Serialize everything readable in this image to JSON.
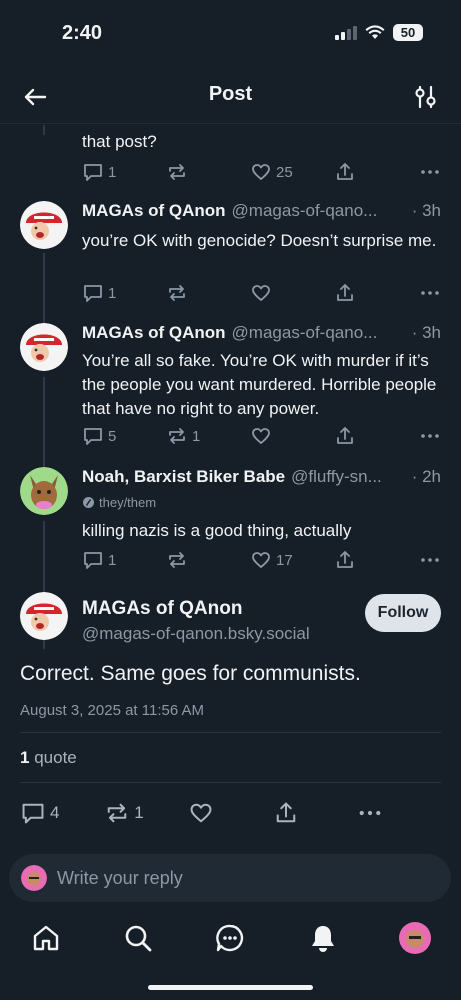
{
  "status": {
    "time": "2:40",
    "battery": "50"
  },
  "header": {
    "title": "Post"
  },
  "top_partial": {
    "text": "that post?",
    "reply_count": "1",
    "like_count": "25"
  },
  "replies": [
    {
      "author": "MAGAs of QAnon",
      "handle": "@magas-of-qano...",
      "time": "· 3h",
      "text": "you’re OK with genocide? Doesn’t surprise me.",
      "reply_count": "1",
      "repost_count": "",
      "like_count": ""
    },
    {
      "author": "MAGAs of QAnon",
      "handle": "@magas-of-qano...",
      "time": "· 3h",
      "text": "You’re all so fake. You’re OK with murder if it’s the people you want murdered. Horrible people that have no right to any power.",
      "reply_count": "5",
      "repost_count": "1",
      "like_count": ""
    },
    {
      "author": "Noah, Barxist Biker Babe",
      "handle": "@fluffy-sn...",
      "time": "· 2h",
      "pronouns": "they/them",
      "text": "killing nazis is a good thing, actually",
      "reply_count": "1",
      "repost_count": "",
      "like_count": "17"
    }
  ],
  "main_post": {
    "author": "MAGAs of QAnon",
    "handle": "@magas-of-qanon.bsky.social",
    "follow_label": "Follow",
    "text": "Correct. Same goes for communists.",
    "date": "August 3, 2025 at 11:56 AM",
    "quote_count": "1",
    "quote_label": "quote",
    "reply_count": "4",
    "repost_count": "1"
  },
  "composer": {
    "placeholder": "Write your reply"
  },
  "tabs": [
    "home-icon",
    "search-icon",
    "chat-icon",
    "bell-icon",
    "profile-avatar"
  ],
  "colors": {
    "background": "#161e27",
    "muted": "#8b98a5",
    "follow_bg": "#dfe4ea",
    "maga_red": "#d4262c"
  }
}
